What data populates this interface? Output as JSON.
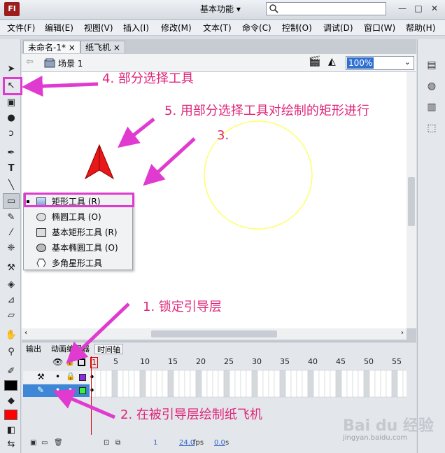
{
  "app": {
    "logo": "Fl",
    "workspace": "基本功能 ▾",
    "search_placeholder": "",
    "window_controls": {
      "minimize": "—",
      "restore": "□",
      "close": "✕"
    }
  },
  "menu": [
    "文件(F)",
    "编辑(E)",
    "视图(V)",
    "插入(I)",
    "修改(M)",
    "文本(T)",
    "命令(C)",
    "控制(O)",
    "调试(D)",
    "窗口(W)",
    "帮助(H)"
  ],
  "doc_tabs": [
    {
      "label": "未命名-1*",
      "close": "×",
      "active": true
    },
    {
      "label": "纸飞机",
      "close": "×",
      "active": false
    }
  ],
  "scene": {
    "label": "场景 1",
    "zoom": "100%"
  },
  "flyout": [
    {
      "label": "矩形工具 (R)",
      "selected": true
    },
    {
      "label": "椭圆工具 (O)",
      "selected": false
    },
    {
      "label": "基本矩形工具 (R)",
      "selected": false
    },
    {
      "label": "基本椭圆工具 (O)",
      "selected": false
    },
    {
      "label": "多角星形工具",
      "selected": false
    }
  ],
  "timeline": {
    "tabs": [
      "输出",
      "动画编辑器",
      "时间轴"
    ],
    "frame_numbers": [
      "1",
      "5",
      "10",
      "15",
      "20",
      "25",
      "30",
      "35",
      "40",
      "45",
      "50",
      "55"
    ],
    "footer": {
      "frame": "1",
      "fps": "24.0",
      "fps_unit": "fps",
      "time": "0.0",
      "time_unit": "s"
    }
  },
  "annotations": {
    "a4": "4. 部分选择工具",
    "a5": "5. 用部分选择工具对绘制的矩形进行",
    "a3": "3.",
    "a1": "1. 锁定引导层",
    "a2": "2. 在被引导层绘制纸飞机"
  },
  "watermark": {
    "brand": "Bai du 经验",
    "url": "jingyan.baidu.com"
  },
  "colors": {
    "stroke_swatch": "#000000",
    "fill_swatch": "#ff0000",
    "annotation": "#e0267a",
    "circle": "#ffff44",
    "plane": "#e81818"
  }
}
